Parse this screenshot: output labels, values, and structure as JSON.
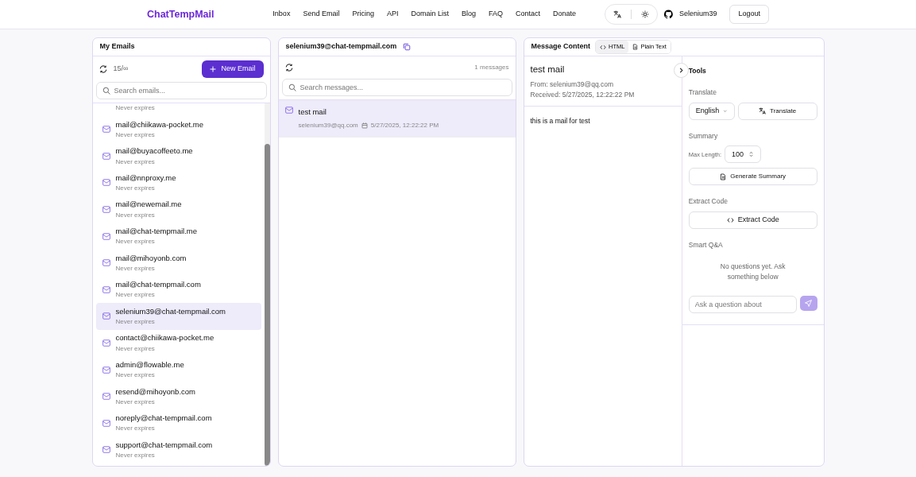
{
  "brand": "ChatTempMail",
  "nav": [
    "Inbox",
    "Send Email",
    "Pricing",
    "API",
    "Domain List",
    "Blog",
    "FAQ",
    "Contact",
    "Donate"
  ],
  "user": {
    "name": "Selenium39",
    "logout": "Logout"
  },
  "emails_panel": {
    "title": "My Emails",
    "count": "15/∞",
    "new_button": "New Email",
    "search_placeholder": "Search emails...",
    "items": [
      {
        "expires": "Never expires",
        "selected": false
      },
      {
        "address": "mail@chiikawa-pocket.me",
        "expires": "Never expires",
        "selected": false
      },
      {
        "address": "mail@buyacoffeeto.me",
        "expires": "Never expires",
        "selected": false
      },
      {
        "address": "mail@nnproxy.me",
        "expires": "Never expires",
        "selected": false
      },
      {
        "address": "mail@newemail.me",
        "expires": "Never expires",
        "selected": false
      },
      {
        "address": "mail@chat-tempmail.me",
        "expires": "Never expires",
        "selected": false
      },
      {
        "address": "mail@mihoyonb.com",
        "expires": "Never expires",
        "selected": false
      },
      {
        "address": "mail@chat-tempmail.com",
        "expires": "Never expires",
        "selected": false
      },
      {
        "address": "selenium39@chat-tempmail.com",
        "expires": "Never expires",
        "selected": true
      },
      {
        "address": "contact@chiikawa-pocket.me",
        "expires": "Never expires",
        "selected": false
      },
      {
        "address": "admin@flowable.me",
        "expires": "Never expires",
        "selected": false
      },
      {
        "address": "resend@mihoyonb.com",
        "expires": "Never expires",
        "selected": false
      },
      {
        "address": "noreply@chat-tempmail.com",
        "expires": "Never expires",
        "selected": false
      },
      {
        "address": "support@chat-tempmail.com",
        "expires": "Never expires",
        "selected": false
      }
    ]
  },
  "messages_panel": {
    "title": "selenium39@chat-tempmail.com",
    "count": "1 messages",
    "search_placeholder": "Search messages...",
    "items": [
      {
        "subject": "test mail",
        "from": "selenium39@qq.com",
        "date": "5/27/2025, 12:22:22 PM",
        "selected": true
      }
    ]
  },
  "content_panel": {
    "title": "Message Content",
    "view_tabs": [
      {
        "label": "HTML",
        "kind": "code",
        "selected": true
      },
      {
        "label": "Plain Text",
        "kind": "file",
        "selected": false
      }
    ],
    "subject": "test mail",
    "from": "From: selenium39@qq.com",
    "received": "Received: 5/27/2025, 12:22:22 PM",
    "body": "this is a mail for test"
  },
  "tools": {
    "title": "Tools",
    "translate_label": "Translate",
    "language": "English",
    "translate_button": "Translate",
    "summary_label": "Summary",
    "max_length_label": "Max Length:",
    "max_length": "100",
    "summary_button": "Generate Summary",
    "extract_label": "Extract Code",
    "extract_button": "Extract Code",
    "qa_label": "Smart Q&A",
    "qa_empty": "No questions yet. Ask something below",
    "qa_placeholder": "Ask a question about"
  }
}
